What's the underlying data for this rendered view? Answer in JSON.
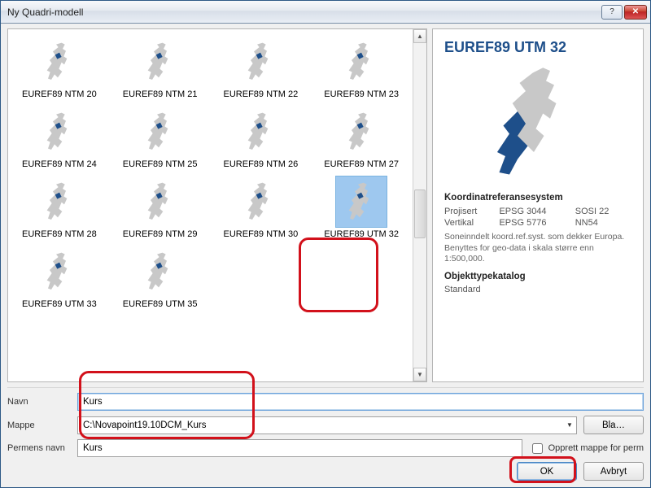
{
  "window": {
    "title": "Ny Quadri-modell"
  },
  "grid": {
    "items": [
      {
        "label": "EUREF89 NTM 20",
        "selected": false
      },
      {
        "label": "EUREF89 NTM 21",
        "selected": false
      },
      {
        "label": "EUREF89 NTM 22",
        "selected": false
      },
      {
        "label": "EUREF89 NTM 23",
        "selected": false
      },
      {
        "label": "EUREF89 NTM 24",
        "selected": false
      },
      {
        "label": "EUREF89 NTM 25",
        "selected": false
      },
      {
        "label": "EUREF89 NTM 26",
        "selected": false
      },
      {
        "label": "EUREF89 NTM 27",
        "selected": false
      },
      {
        "label": "EUREF89 NTM 28",
        "selected": false
      },
      {
        "label": "EUREF89 NTM 29",
        "selected": false
      },
      {
        "label": "EUREF89 NTM 30",
        "selected": false
      },
      {
        "label": "EUREF89 UTM 32",
        "selected": true
      },
      {
        "label": "EUREF89 UTM 33",
        "selected": false
      },
      {
        "label": "EUREF89 UTM 35",
        "selected": false
      }
    ]
  },
  "detail": {
    "title": "EUREF89 UTM 32",
    "crs_header": "Koordinatreferansesystem",
    "rows": [
      {
        "k": "Projisert",
        "v1": "EPSG 3044",
        "v2": "SOSI 22"
      },
      {
        "k": "Vertikal",
        "v1": "EPSG 5776",
        "v2": "NN54"
      }
    ],
    "desc": "Soneinndelt koord.ref.syst. som dekker Europa. Benyttes for geo-data i skala større enn 1:500,000.",
    "cat_header": "Objekttypekatalog",
    "cat_value": "Standard"
  },
  "form": {
    "navn_label": "Navn",
    "navn_value": "Kurs",
    "mappe_label": "Mappe",
    "mappe_value": "C:\\Novapoint19.10DCM_Kurs",
    "browse_label": "Bla…",
    "perm_label": "Permens navn",
    "perm_value": "Kurs",
    "create_folder_label": "Opprett mappe for perm",
    "create_folder_checked": false
  },
  "buttons": {
    "ok": "OK",
    "cancel": "Avbryt"
  }
}
